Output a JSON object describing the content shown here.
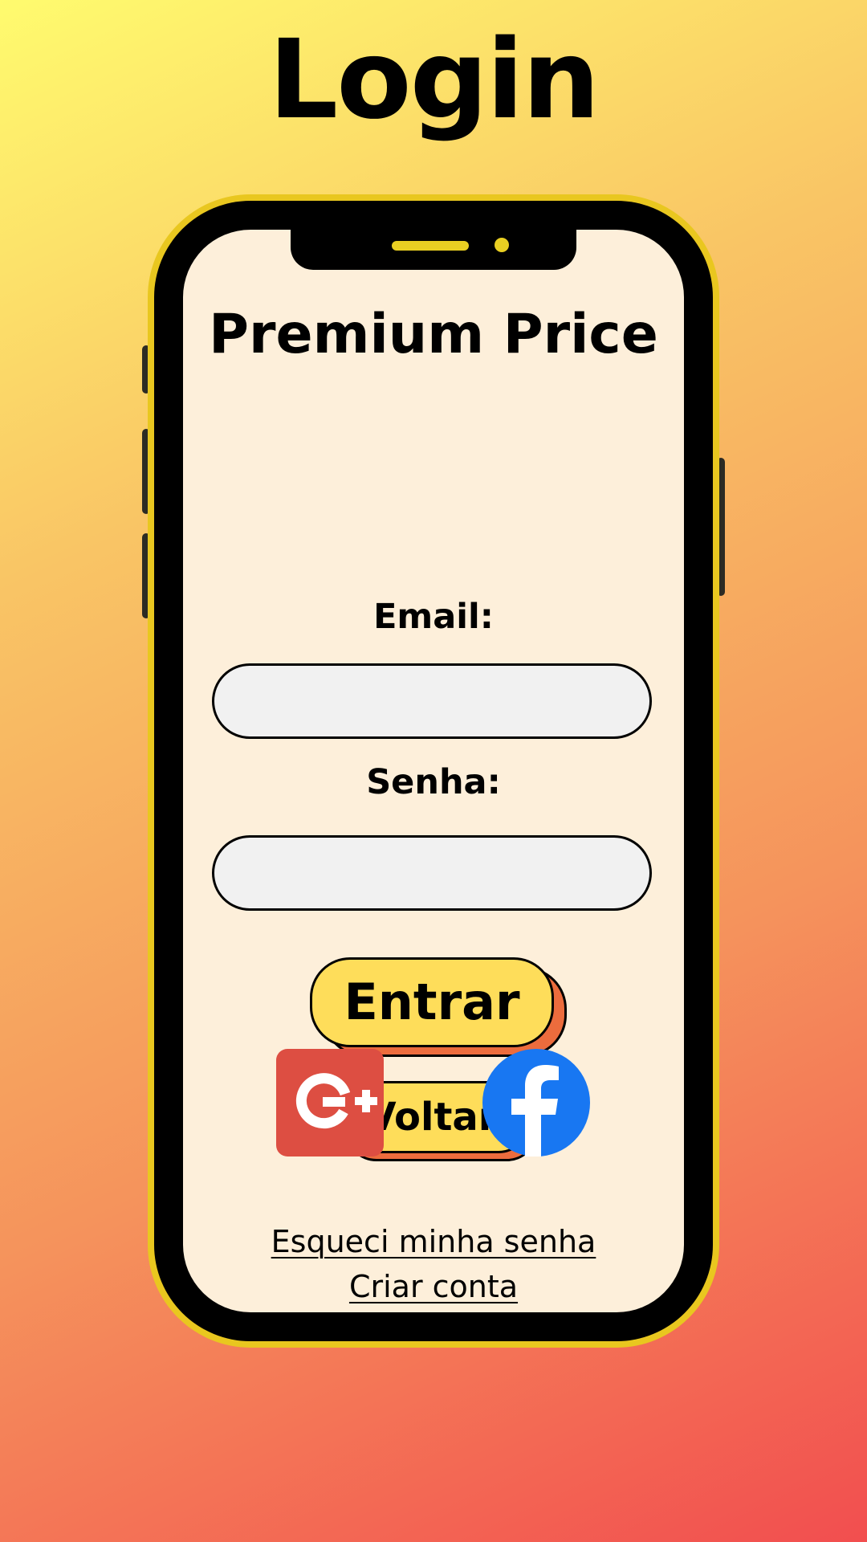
{
  "page": {
    "title": "Login"
  },
  "app": {
    "title": "Premium Price"
  },
  "form": {
    "email_label": "Email:",
    "email_value": "",
    "email_placeholder": "",
    "password_label": "Senha:",
    "password_value": "",
    "password_placeholder": ""
  },
  "buttons": {
    "enter_label": "Entrar",
    "back_label": "Voltar"
  },
  "social": {
    "google_icon": "google-plus-icon",
    "facebook_icon": "facebook-icon",
    "google_color": "#dd4e42",
    "facebook_color": "#1877f2"
  },
  "links": {
    "forgot_password": "Esqueci minha senha",
    "create_account": "Criar conta"
  },
  "colors": {
    "phone_frame": "#e9c71f",
    "screen_bg": "#fdefda",
    "button_fill": "#fedd5a",
    "button_shadow": "#ec6c3d"
  }
}
